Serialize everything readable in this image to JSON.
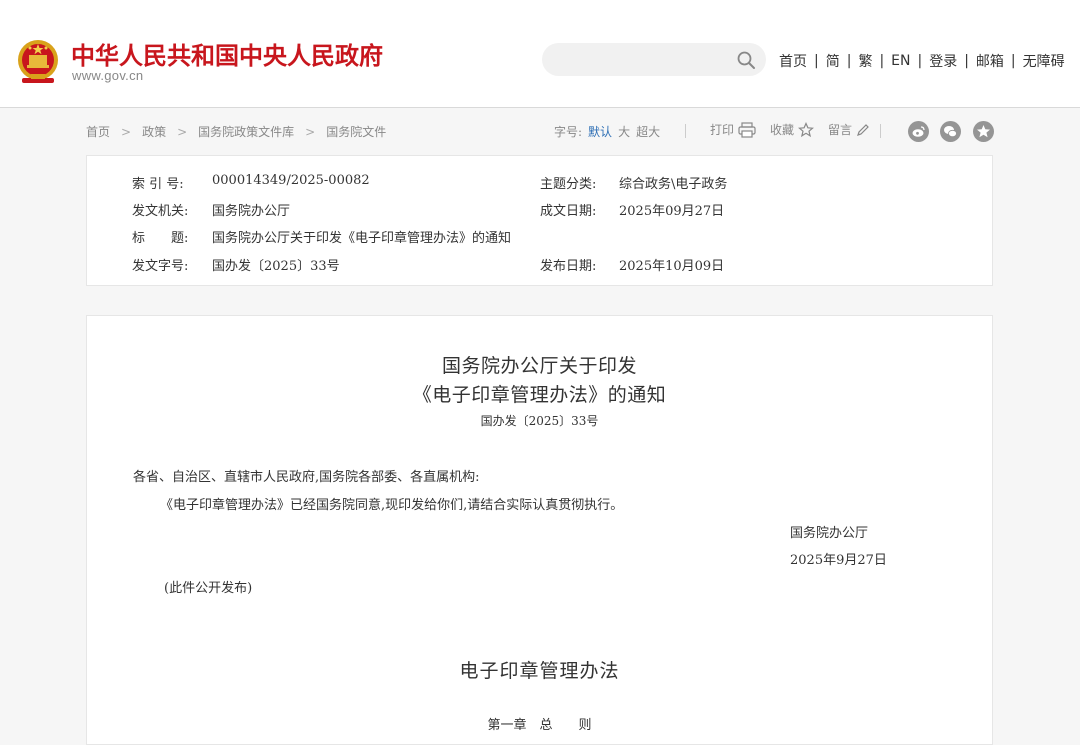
{
  "header": {
    "site_name": "中华人民共和国中央人民政府",
    "site_domain": "www.gov.cn",
    "search": {
      "placeholder": ""
    },
    "nav": [
      "首页",
      "简",
      "繁",
      "EN",
      "登录",
      "邮箱",
      "无障碍"
    ],
    "nav_separator": "|"
  },
  "breadcrumb": {
    "items": [
      "首页",
      "政策",
      "国务院政策文件库",
      "国务院文件"
    ],
    "separator": ">"
  },
  "font_size": {
    "label": "字号:",
    "options": [
      "默认",
      "大",
      "超大"
    ],
    "active": "默认"
  },
  "tools": {
    "print": "打印",
    "favorite": "收藏",
    "comment": "留言"
  },
  "share_icons": [
    "weibo-icon",
    "wechat-icon",
    "qzone-icon"
  ],
  "info": {
    "index_label": "索 引 号:",
    "index_value": "000014349/2025-00082",
    "topic_label": "主题分类:",
    "topic_value": "综合政务\\电子政务",
    "issuer_label": "发文机关:",
    "issuer_value": "国务院办公厅",
    "written_label": "成文日期:",
    "written_value": "2025年09月27日",
    "title_label": "标　　题:",
    "title_value": "国务院办公厅关于印发《电子印章管理办法》的通知",
    "doc_no_label": "发文字号:",
    "doc_no_value": "国办发〔2025〕33号",
    "publish_label": "发布日期:",
    "publish_value": "2025年10月09日"
  },
  "document": {
    "title_line1": "国务院办公厅关于印发",
    "title_line2": "《电子印章管理办法》的通知",
    "number": "国办发〔2025〕33号",
    "addressee": "各省、自治区、直辖市人民政府,国务院各部委、各直属机构:",
    "body": "《电子印章管理办法》已经国务院同意,现印发给你们,请结合实际认真贯彻执行。",
    "signer": "国务院办公厅",
    "date": "2025年9月27日",
    "note": "(此件公开发布)",
    "measures_title": "电子印章管理办法",
    "chapter": "第一章　总　　则"
  },
  "colors": {
    "brand_red": "#c8161d",
    "link_blue": "#2e6fb5",
    "background": "#f6f6f6"
  }
}
